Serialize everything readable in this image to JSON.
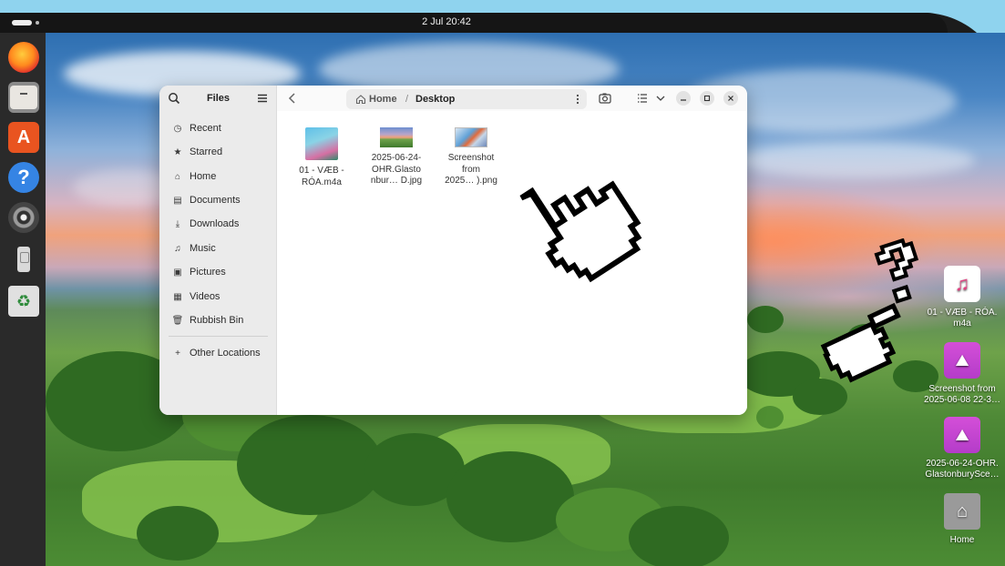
{
  "topbar": {
    "clock": "2 Jul  20:42"
  },
  "dock": {
    "items": [
      {
        "name": "firefox-icon"
      },
      {
        "name": "files-icon"
      },
      {
        "name": "app-center-icon",
        "glyph": "A"
      },
      {
        "name": "help-icon",
        "glyph": "?"
      },
      {
        "name": "rhythmbox-icon"
      },
      {
        "name": "usb-drive-icon"
      },
      {
        "name": "trash-icon",
        "glyph": "♻"
      }
    ]
  },
  "window": {
    "app_title": "Files",
    "sidebar": {
      "items": [
        {
          "label": "Recent",
          "icon": "clock-icon",
          "glyph": "◷"
        },
        {
          "label": "Starred",
          "icon": "star-icon",
          "glyph": "★"
        },
        {
          "label": "Home",
          "icon": "home-icon",
          "glyph": "⌂"
        },
        {
          "label": "Documents",
          "icon": "document-icon",
          "glyph": "▤"
        },
        {
          "label": "Downloads",
          "icon": "download-icon",
          "glyph": "⤓"
        },
        {
          "label": "Music",
          "icon": "music-icon",
          "glyph": "♫"
        },
        {
          "label": "Pictures",
          "icon": "pictures-icon",
          "glyph": "▣"
        },
        {
          "label": "Videos",
          "icon": "video-icon",
          "glyph": "▦"
        },
        {
          "label": "Rubbish Bin",
          "icon": "trash-icon",
          "glyph": "🗑"
        }
      ],
      "other_locations": {
        "label": "Other Locations",
        "glyph": "+"
      }
    },
    "pathbar": {
      "home": "Home",
      "separator": "/",
      "current": "Desktop"
    },
    "files": [
      {
        "line1": "01 - VÆB -",
        "line2": "RÓA.m4a",
        "line3": "",
        "kind": "music"
      },
      {
        "line1": "2025-06-24-",
        "line2": "OHR.Glasto",
        "line3": "nbur… D.jpg",
        "kind": "photo"
      },
      {
        "line1": "Screenshot",
        "line2": "from",
        "line3": "2025… ).png",
        "kind": "shot"
      }
    ]
  },
  "desktop": {
    "icons": [
      {
        "line1": "01 - VÆB - RÓA.",
        "line2": "m4a",
        "kind": "music",
        "glyph": "♫"
      },
      {
        "line1": "Screenshot from",
        "line2": "2025-06-08 22-3…",
        "kind": "img",
        "glyph": "⛰"
      },
      {
        "line1": "2025-06-24-OHR.",
        "line2": "GlastonburySce…",
        "kind": "img",
        "glyph": "⛰"
      },
      {
        "line1": "Home",
        "line2": "",
        "kind": "home",
        "glyph": "⌂"
      }
    ]
  }
}
